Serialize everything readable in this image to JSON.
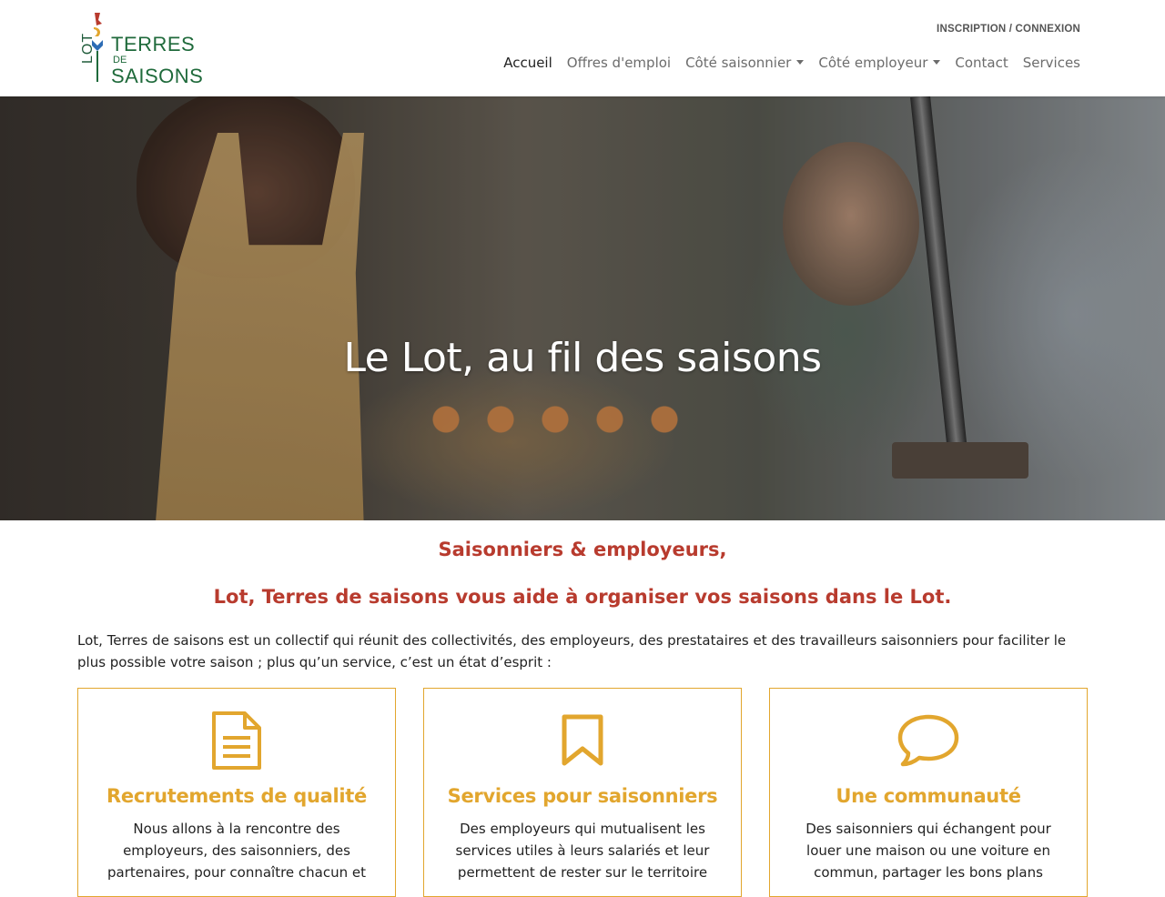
{
  "brand": {
    "lot": "LOT",
    "line1": "TERRES",
    "line2": "DE",
    "line3": "SAISONS",
    "colors": {
      "green": "#1f6a3b",
      "orange": "#e2a62e",
      "red": "#b83b2e",
      "blue": "#2d6cb5"
    }
  },
  "header": {
    "top_link": "INSCRIPTION / CONNEXION",
    "nav": [
      {
        "label": "Accueil",
        "active": true
      },
      {
        "label": "Offres d'emploi"
      },
      {
        "label": "Côté saisonnier",
        "dropdown": true
      },
      {
        "label": "Côté employeur",
        "dropdown": true
      },
      {
        "label": "Contact"
      },
      {
        "label": "Services"
      }
    ]
  },
  "hero": {
    "title": "Le Lot, au fil des saisons"
  },
  "intro": {
    "line1": "Saisonniers & employeurs,",
    "line2": "Lot, Terres de saisons vous aide à organiser vos saisons dans le Lot.",
    "paragraph": "Lot, Terres de saisons est un collectif qui réunit des collectivités, des employeurs, des prestataires et des travailleurs saisonniers pour faciliter le plus possible votre saison ; plus qu’un service, c’est un état d’esprit :"
  },
  "cards": [
    {
      "icon": "document-icon",
      "title": "Recrutements de qualité",
      "text": "Nous allons à la rencontre des employeurs, des saisonniers, des partenaires, pour connaître chacun et"
    },
    {
      "icon": "bookmark-icon",
      "title": "Services pour saisonniers",
      "text": "Des employeurs qui mutualisent les services utiles à leurs salariés et leur permettent de rester sur le territoire"
    },
    {
      "icon": "speech-bubble-icon",
      "title": "Une communauté",
      "text": "Des saisonniers qui échangent pour louer une maison ou une voiture en commun, partager les bons plans"
    }
  ]
}
